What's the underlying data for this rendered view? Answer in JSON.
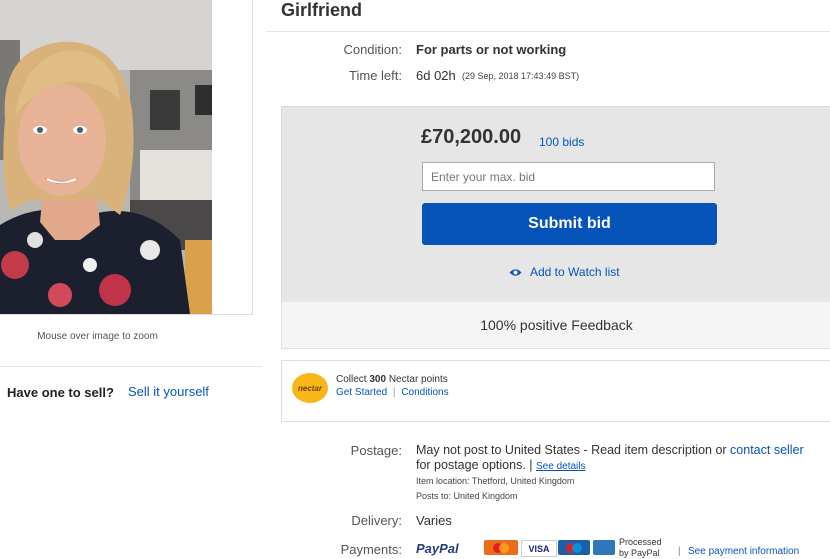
{
  "listing": {
    "title": "Girlfriend",
    "condition_label": "Condition:",
    "condition_value": "For parts or not working",
    "time_left_label": "Time left:",
    "time_left_value": "6d 02h",
    "time_left_detail": "(29 Sep, 2018  17:43:49 BST)"
  },
  "gallery": {
    "zoom_hint": "Mouse over image to zoom"
  },
  "sell": {
    "question": "Have one to sell?",
    "link": "Sell it yourself"
  },
  "bid": {
    "price": "£70,200.00",
    "bids_link": "100 bids",
    "input_placeholder": "Enter your max. bid",
    "submit_label": "Submit bid",
    "watch_label": "Add to Watch list",
    "feedback": "100% positive Feedback"
  },
  "nectar": {
    "logo_text": "nectar",
    "collect_prefix": "Collect ",
    "points": "300",
    "collect_suffix": " Nectar points",
    "get_started": "Get Started",
    "separator": "|",
    "conditions": "Conditions"
  },
  "postage": {
    "label": "Postage:",
    "text": "May not post to United States - Read item description or ",
    "contact_link": "contact seller",
    "text2": "for postage options. | ",
    "see_details": "See details",
    "item_location": "Item location:  Thetford, United Kingdom",
    "posts_to": "Posts to:  United Kingdom"
  },
  "delivery": {
    "label": "Delivery:",
    "value": "Varies"
  },
  "payments": {
    "label": "Payments:",
    "paypal": "PayPal",
    "visa": "VISA",
    "processed": "Processed",
    "by_paypal": "by PayPal",
    "see_info": "See payment information"
  },
  "colors": {
    "link": "#0654ba",
    "button": "#0654ba",
    "bid_panel": "#e6e6e6",
    "nectar": "#f7b719"
  },
  "icons": [
    "eye-icon",
    "nectar-logo",
    "paypal-logo",
    "mastercard-logo",
    "visa-logo",
    "maestro-logo",
    "amex-logo"
  ]
}
